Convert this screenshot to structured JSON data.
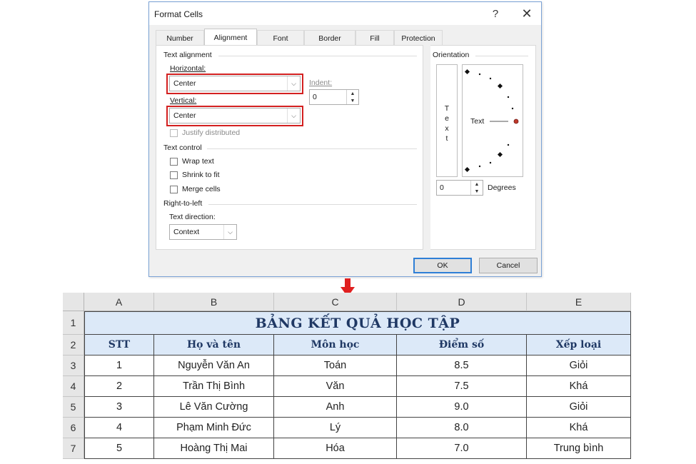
{
  "dialog": {
    "title": "Format Cells",
    "help_label": "?",
    "close_label": "✕",
    "tabs": [
      {
        "label": "Number",
        "active": false
      },
      {
        "label": "Alignment",
        "active": true
      },
      {
        "label": "Font",
        "active": false
      },
      {
        "label": "Border",
        "active": false
      },
      {
        "label": "Fill",
        "active": false
      },
      {
        "label": "Protection",
        "active": false
      }
    ],
    "text_alignment": {
      "group_label": "Text alignment",
      "horizontal_label": "Horizontal:",
      "horizontal_value": "Center",
      "vertical_label": "Vertical:",
      "vertical_value": "Center",
      "indent_label": "Indent:",
      "indent_value": "0",
      "justify_distributed_label": "Justify distributed"
    },
    "text_control": {
      "group_label": "Text control",
      "wrap_text_label": "Wrap text",
      "shrink_to_fit_label": "Shrink to fit",
      "merge_cells_label": "Merge cells"
    },
    "right_to_left": {
      "group_label": "Right-to-left",
      "text_direction_label": "Text direction:",
      "text_direction_value": "Context"
    },
    "orientation": {
      "group_label": "Orientation",
      "vertical_text": [
        "T",
        "e",
        "x",
        "t"
      ],
      "angle_text": "Text",
      "degrees_value": "0",
      "degrees_label": "Degrees",
      "pointer_color": "#c0392b"
    },
    "ok_label": "OK",
    "cancel_label": "Cancel",
    "highlight_color": "#d32020"
  },
  "sheet": {
    "columns": [
      "A",
      "B",
      "C",
      "D",
      "E"
    ],
    "row_numbers": [
      "1",
      "2",
      "3",
      "4",
      "5",
      "6",
      "7"
    ],
    "title": "BẢNG KẾT QUẢ HỌC TẬP",
    "headers": [
      "STT",
      "Họ và tên",
      "Môn học",
      "Điểm số",
      "Xếp loại"
    ],
    "rows": [
      [
        "1",
        "Nguyễn Văn An",
        "Toán",
        "8.5",
        "Giỏi"
      ],
      [
        "2",
        "Trần Thị Bình",
        "Văn",
        "7.5",
        "Khá"
      ],
      [
        "3",
        "Lê Văn Cường",
        "Anh",
        "9.0",
        "Giỏi"
      ],
      [
        "4",
        "Phạm Minh Đức",
        "Lý",
        "8.0",
        "Khá"
      ],
      [
        "5",
        "Hoàng Thị Mai",
        "Hóa",
        "7.0",
        "Trung bình"
      ]
    ],
    "header_fill": "#dce9f8",
    "header_text_color": "#1f3864"
  }
}
